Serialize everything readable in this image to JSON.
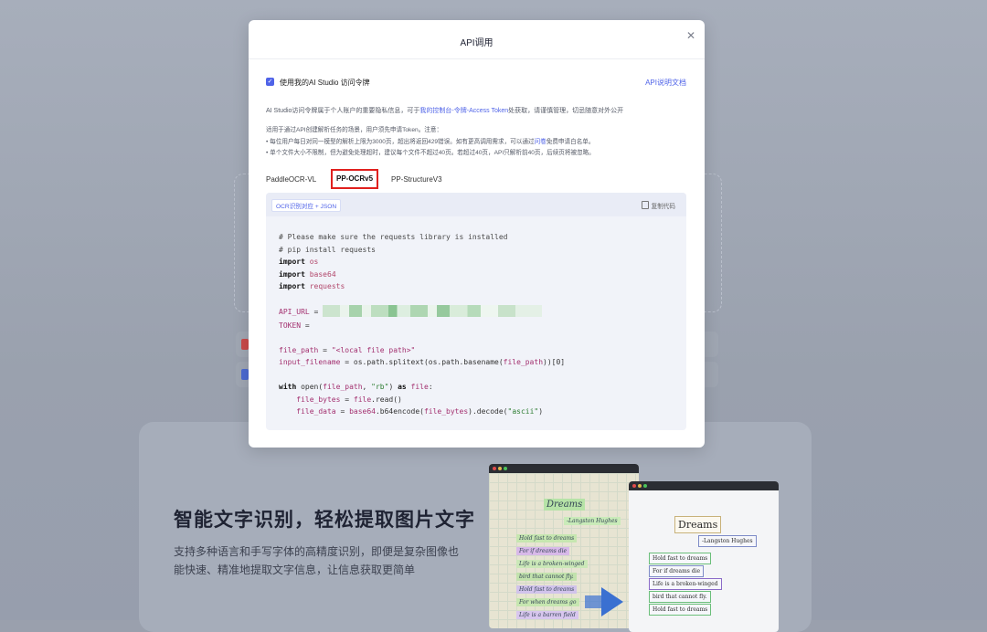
{
  "modal": {
    "title": "API调用",
    "close_icon": "close-icon",
    "checkbox_label": "使用我的AI Studio 访问令牌",
    "checkbox_checked": true,
    "doc_link": "API说明文档",
    "para1_prefix": "AI Studio访问令牌属于个人账户的重要隐私信息，可于",
    "para1_link": "我的控制台-令牌-Access Token",
    "para1_suffix": "处获取，请谨慎管理，切忌随意对外公开",
    "para2_intro": "适用于通过API创建解析任务的场景，用户须先申请Token。注意：",
    "bullet1_prefix": "• 每位用户每日对同一模型的解析上限为3000页，超出将返回429错误。如有更高调用需求，可以通过",
    "bullet1_link": "问卷",
    "bullet1_suffix": "免费申请白名单。",
    "bullet2": "• 单个文件大小不限制，但为避免处理超时，建议每个文件不超过40页。若超过40页，API只解析前40页，后续页将被忽略。",
    "tabs": [
      {
        "label": "PaddleOCR-VL"
      },
      {
        "label": "PP-OCRv5",
        "active": true
      },
      {
        "label": "PP-StructureV3"
      }
    ],
    "code": {
      "badge": "OCR识别对应 + JSON",
      "copy_label": "复制代码",
      "copy_icon": "copy-icon",
      "comment1": "# Please make sure the requests library is installed",
      "comment2": "# pip install requests",
      "kw_import": "import",
      "mod_os": "os",
      "mod_base64": "base64",
      "mod_requests": "requests",
      "api_url": "API_URL",
      "token": "TOKEN",
      "eq": " = ",
      "file_path_var": "file_path",
      "file_path_val": "\"<local file path>\"",
      "input_filename_var": "input_filename",
      "line_input_rest_a": " = os.path.splitext(os.path.basename(",
      "line_input_rest_b": "))[0]",
      "kw_with": "with",
      "line_with_a": " open(",
      "line_with_b": ", ",
      "rb": "\"rb\"",
      "line_with_c": ") ",
      "kw_as": "as",
      "file_var": "file",
      "colon": ":",
      "file_bytes_var": "file_bytes",
      "line_bytes_rest": " = ",
      "read_call": ".read()",
      "file_data_var": "file_data",
      "b64_call": "base64",
      "b64_rest_a": ".b64encode(",
      "b64_rest_b": ").decode(",
      "ascii": "\"ascii\"",
      "close_paren": ")"
    }
  },
  "background": {
    "headline": "智能文字识别，轻松提取图片文字",
    "sub": "支持多种语言和手写字体的高精度识别，即便是复杂图像也能快速、精准地提取文字信息，让信息获取更简单",
    "left_tags": [
      "Dreams",
      "-Langston Hughes",
      "Hold fast to dreams",
      "For if dreams die",
      "Life is a broken-winged",
      "bird that cannot fly.",
      "Hold fast to dreams",
      "For when dreams go",
      "Life is a barren field"
    ],
    "right_boxes": [
      "Dreams",
      "-Langston Hughes",
      "Hold fast to dreams",
      "For if dreams die",
      "Life is a broken-winged",
      "bird that cannot fly.",
      "Hold fast to dreams"
    ]
  }
}
